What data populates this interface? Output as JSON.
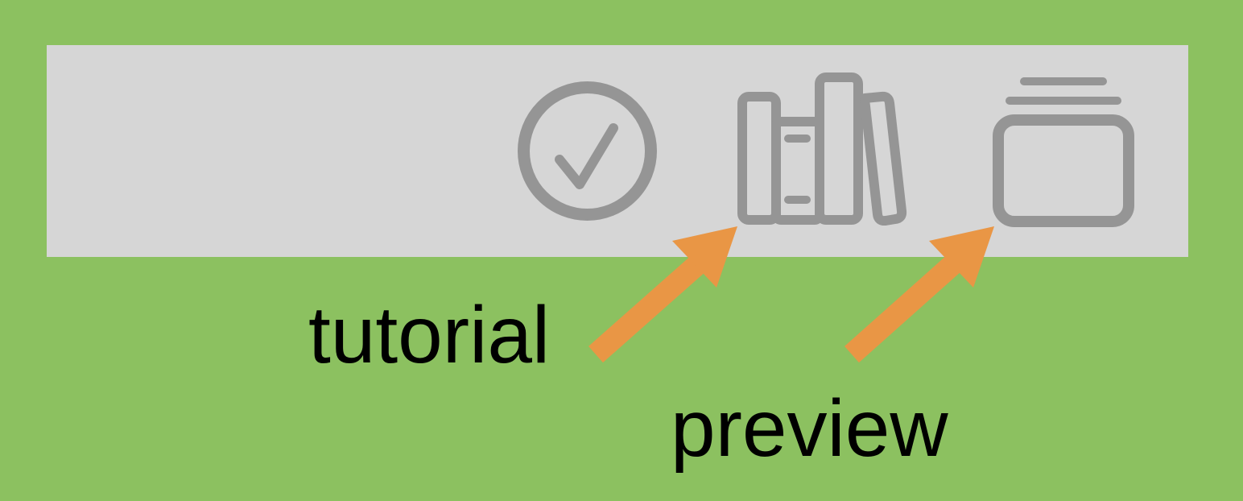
{
  "colors": {
    "background": "#8cc160",
    "toolbar": "#d6d6d6",
    "icon": "#959595",
    "arrow": "#e99645",
    "label": "#000000"
  },
  "toolbar": {
    "icons": [
      {
        "name": "checkmark-circle-icon"
      },
      {
        "name": "books-library-icon"
      },
      {
        "name": "stacked-cards-icon"
      }
    ]
  },
  "annotations": {
    "tutorial_label": "tutorial",
    "preview_label": "preview"
  }
}
